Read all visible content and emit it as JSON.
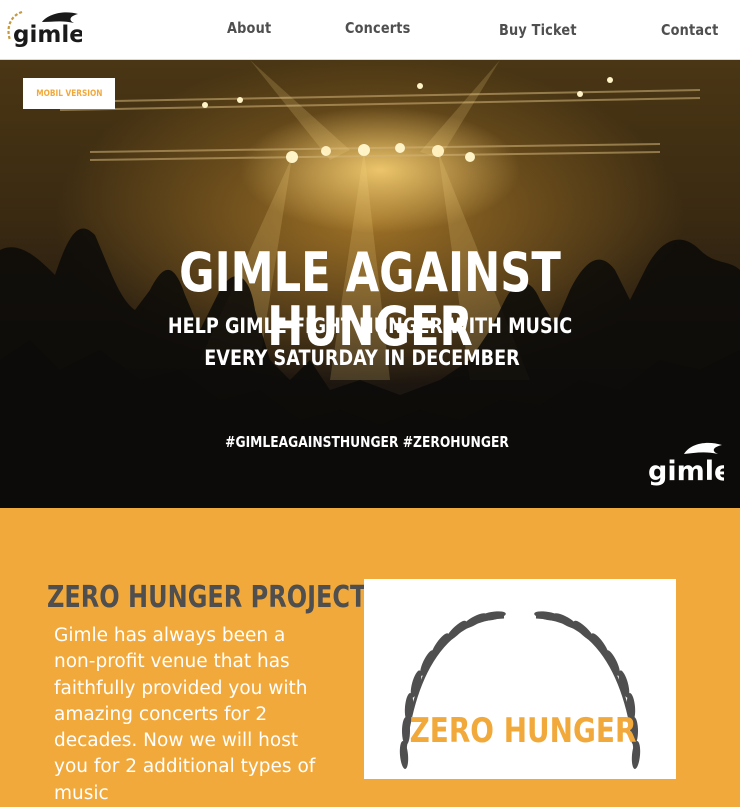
{
  "nav": {
    "logo_text": "gimle",
    "links": [
      "About",
      "Concerts",
      "Buy Ticket",
      "Contact"
    ]
  },
  "hero": {
    "mobile_button": "Mobil version",
    "title": "Gimle against hunger",
    "subtitle_1": "Help Gimle fight hunger with music",
    "subtitle_2": "every saturday in december",
    "hashtags": "#gimleagainsthunger #zerohunger",
    "logo_text": "gimle"
  },
  "section": {
    "title": "Zero hunger project",
    "body": "Gimle has always been a non-profit venue that has faithfully provided you with amazing concerts for 2 decades. Now we will host you for 2 additional types of music",
    "card_title": "Zero hunger"
  },
  "colors": {
    "accent": "#f2a93b",
    "text_dark": "#4f4f4f",
    "white": "#ffffff"
  }
}
